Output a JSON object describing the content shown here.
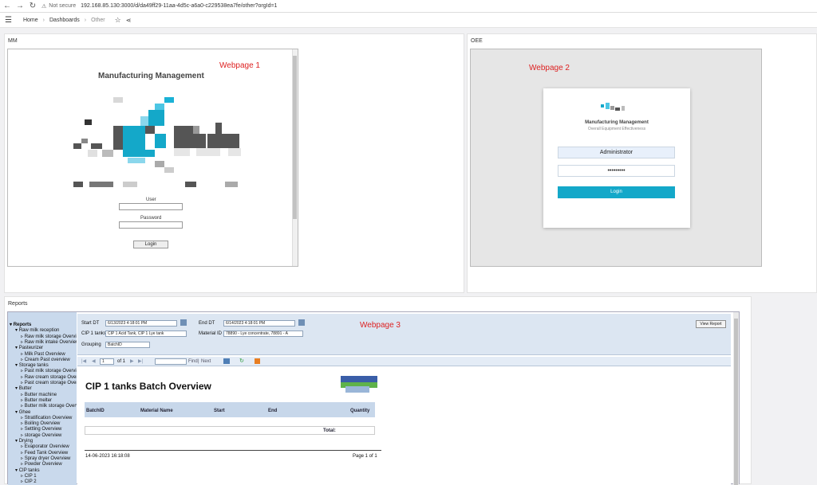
{
  "browser": {
    "not_secure": "Not secure",
    "url": "192.168.85.130:3000/d/da49ff29-11aa-4d5c-a6a0-c229538ea7fe/other?orgId=1"
  },
  "breadcrumb": {
    "home": "Home",
    "dashboards": "Dashboards",
    "current": "Other"
  },
  "panels": {
    "mm": {
      "title": "MM",
      "label": "Webpage 1"
    },
    "oee": {
      "title": "OEE",
      "label": "Webpage 2"
    },
    "reports": {
      "title": "Reports",
      "label": "Webpage 3"
    }
  },
  "webpage1": {
    "title": "Manufacturing Management",
    "user_label": "User",
    "password_label": "Password",
    "login": "Login"
  },
  "webpage2": {
    "title": "Manufacturing Management",
    "subtitle": "Overall Equipment Effectiveness",
    "username": "Administrator",
    "password": "•••••••••",
    "login": "Login"
  },
  "webpage3": {
    "tree": [
      "Reports",
      "Raw milk reception",
      "Raw milk storage Overview",
      "Raw milk intake Overview",
      "Pasteurizer",
      "Milk Past Overview",
      "Cream Past overview",
      "Storage tanks",
      "Past milk storage Overview",
      "Raw cream storage Overview",
      "Past cream storage Overview",
      "Butter",
      "Butter machine",
      "Butter melter",
      "Butter milk storage Overview",
      "Ghee",
      "Stratification Overview",
      "Boiling Overview",
      "Settling Overview",
      "storage Overview",
      "Drying",
      "Evaporator Overview",
      "Feed Tank Overview",
      "Spray dryer Overview",
      "Powder Overview",
      "CIP tanks",
      "CIP 1",
      "CIP 2"
    ],
    "params": {
      "start_dt_label": "Start DT",
      "start_dt": "6/13/2023 4:18:01 PM",
      "end_dt_label": "End DT",
      "end_dt": "6/14/2023 4:18:01 PM",
      "cip_label": "CIP 1 tanks",
      "cip_value": "CIP 1 Acid Tank, CIP 1 Lye tank",
      "material_label": "Material ID",
      "material_value": "78890 - Lye concentrate, 78891 - A",
      "grouping_label": "Grouping",
      "grouping_value": "BatchID",
      "view_report": "View Report"
    },
    "toolbar": {
      "page": "1",
      "of": "of 1",
      "find": "Find",
      "next": "Next"
    },
    "report": {
      "title": "CIP 1 tanks Batch Overview",
      "columns": [
        "BatchID",
        "Material Name",
        "Start",
        "End",
        "Quantity"
      ],
      "total": "Total:",
      "footer_date": "14-06-2023 16:18:08",
      "footer_page": "Page 1 of 1"
    }
  },
  "colors": {
    "accent": "#14a8c9",
    "label_red": "#dd2222",
    "tree_bg": "#c9d9ec"
  }
}
